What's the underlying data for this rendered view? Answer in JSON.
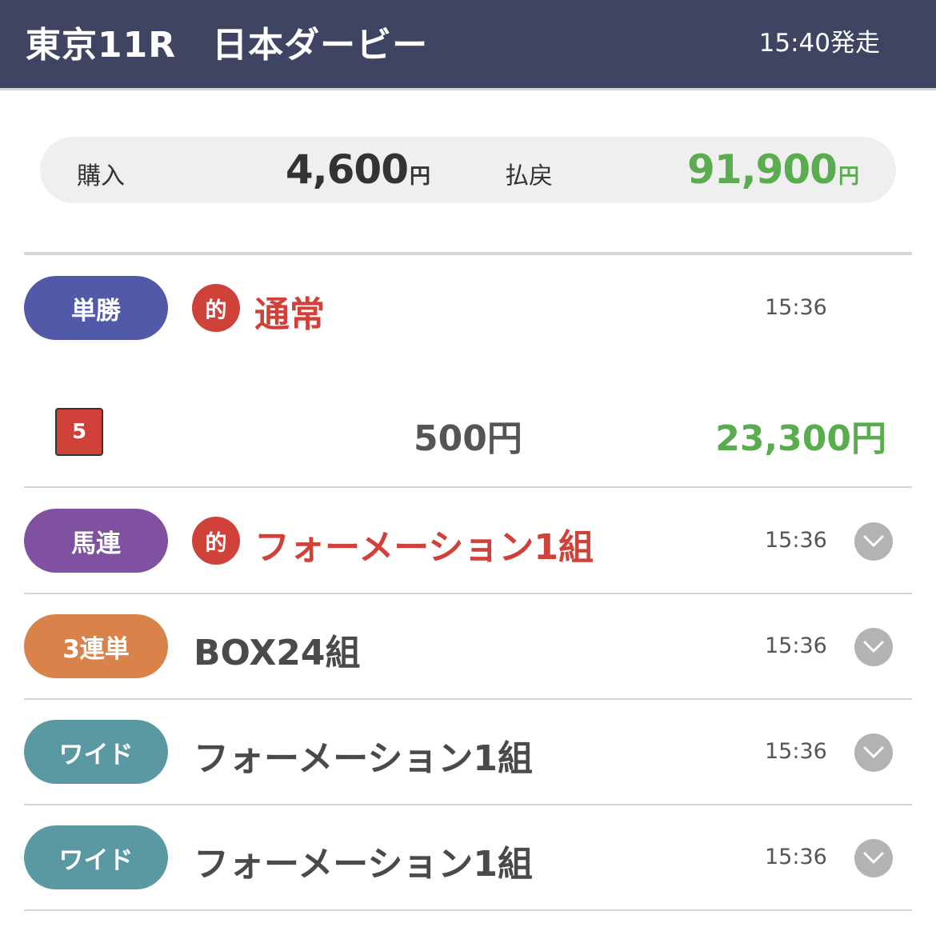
{
  "header": {
    "title": "東京11R　日本ダービー",
    "post_time": "15:40発走"
  },
  "summary": {
    "purchase_label": "購入",
    "purchase_value": "4,600",
    "purchase_unit": "円",
    "payout_label": "払戻",
    "payout_value": "91,900",
    "payout_unit": "円"
  },
  "hit_mark": "的",
  "tickets": [
    {
      "type": "単勝",
      "color": "#5259a8",
      "hit": true,
      "title": "通常",
      "time": "15:36",
      "expandable": false,
      "detail": {
        "horse": "5",
        "stake": "500円",
        "payout": "23,300円"
      }
    },
    {
      "type": "馬連",
      "color": "#7f51a0",
      "hit": true,
      "title": "フォーメーション1組",
      "time": "15:36",
      "expandable": true
    },
    {
      "type": "3連単",
      "color": "#d9834b",
      "hit": false,
      "title": "BOX24組",
      "time": "15:36",
      "expandable": true
    },
    {
      "type": "ワイド",
      "color": "#5a98a2",
      "hit": false,
      "title": "フォーメーション1組",
      "time": "15:36",
      "expandable": true
    },
    {
      "type": "ワイド",
      "color": "#5a98a2",
      "hit": false,
      "title": "フォーメーション1組",
      "time": "15:36",
      "expandable": true
    }
  ],
  "icons": {
    "expand": "chevron-down-icon"
  }
}
